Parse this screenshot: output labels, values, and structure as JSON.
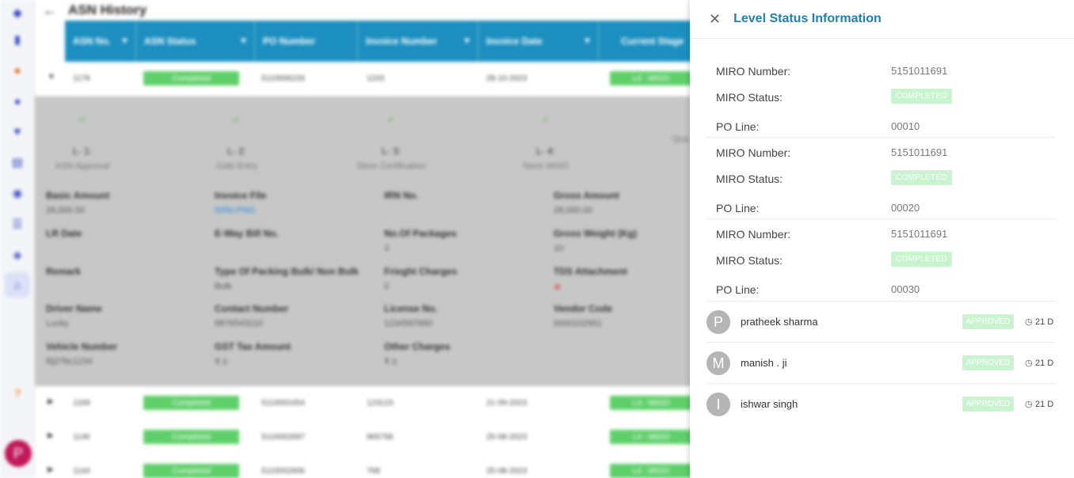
{
  "background": {
    "page_title": "ASN History",
    "columns": [
      "ASN No.",
      "ASN Status",
      "PO Number",
      "Invoice Number",
      "Invoice Date",
      "Current Stage"
    ],
    "rows": [
      {
        "asn": "1179",
        "status": "Completed",
        "po": "5110006233",
        "invoice": "1243",
        "date": "28-10-2023",
        "stage": "L4 - MIGO"
      },
      {
        "asn": "1169",
        "status": "Completed",
        "po": "5110002454",
        "invoice": "123123",
        "date": "21-09-2023",
        "stage": "L4 - MIGO"
      },
      {
        "asn": "1146",
        "status": "Completed",
        "po": "5110002697",
        "invoice": "865768",
        "date": "25-08-2023",
        "stage": "L4 - MIGO"
      },
      {
        "asn": "1144",
        "status": "Completed",
        "po": "5110002606",
        "invoice": "768",
        "date": "25-08-2023",
        "stage": "L4 - MIGO"
      }
    ],
    "stages": [
      {
        "level": "L- 1:",
        "name": "ASN Approval"
      },
      {
        "level": "L- 2:",
        "name": "Gate Entry"
      },
      {
        "level": "L- 3:",
        "name": "Store Certification"
      },
      {
        "level": "L- 4:",
        "name": "Store MIGO"
      },
      {
        "level": "",
        "name": "Qua"
      }
    ],
    "details": [
      {
        "label": "Basic Amount",
        "value": "28,000.00"
      },
      {
        "label": "Invoice File",
        "value": "5050.PNG"
      },
      {
        "label": "IRN No.",
        "value": ""
      },
      {
        "label": "Gross Amount",
        "value": "28,000.00"
      },
      {
        "label": "LR Date",
        "value": ""
      },
      {
        "label": "E-Way Bill No.",
        "value": ""
      },
      {
        "label": "No.Of Packages",
        "value": "3"
      },
      {
        "label": "Gross Weight (Kg)",
        "value": "10"
      },
      {
        "label": "Remark",
        "value": ""
      },
      {
        "label": "Type Of Packing Bulk/ Non Bulk",
        "value": "Bulk"
      },
      {
        "label": "Frieght Charges",
        "value": "0"
      },
      {
        "label": "TDS Attachment",
        "value": ""
      },
      {
        "label": "Driver Name",
        "value": "Lucky"
      },
      {
        "label": "Contact Number",
        "value": "9876543210"
      },
      {
        "label": "License No.",
        "value": "1234567890"
      },
      {
        "label": "Vendor Code",
        "value": "0000102951"
      },
      {
        "label": "Vehicle Number",
        "value": "Rj27bc1234"
      },
      {
        "label": "GST Tax Amount",
        "value": "₹ 0"
      },
      {
        "label": "Other Charges",
        "value": "₹ 0"
      }
    ],
    "user_initial": "P"
  },
  "panel": {
    "title": "Level Status Information",
    "close_icon": "close-icon",
    "labels": {
      "miro_number": "MIRO Number:",
      "miro_status": "MIRO Status:",
      "po_line": "PO Line:"
    },
    "miro_entries": [
      {
        "miro_number": "5151011691",
        "miro_status": "COMPLETED",
        "po_line": "00010"
      },
      {
        "miro_number": "5151011691",
        "miro_status": "COMPLETED",
        "po_line": "00020"
      },
      {
        "miro_number": "5151011691",
        "miro_status": "COMPLETED",
        "po_line": "00030"
      }
    ],
    "approvers": [
      {
        "initial": "P",
        "name": "pratheek sharma",
        "status": "APPROVED",
        "age": "21 D"
      },
      {
        "initial": "M",
        "name": "manish . ji",
        "status": "APPROVED",
        "age": "21 D"
      },
      {
        "initial": "I",
        "name": "ishwar singh",
        "status": "APPROVED",
        "age": "21 D"
      }
    ],
    "colors": {
      "title": "#1e7fb0",
      "badge_bg": "#c8f5d0",
      "avatar_bg": "#b5b5b5",
      "header_bg": "#1c8fc0"
    }
  }
}
